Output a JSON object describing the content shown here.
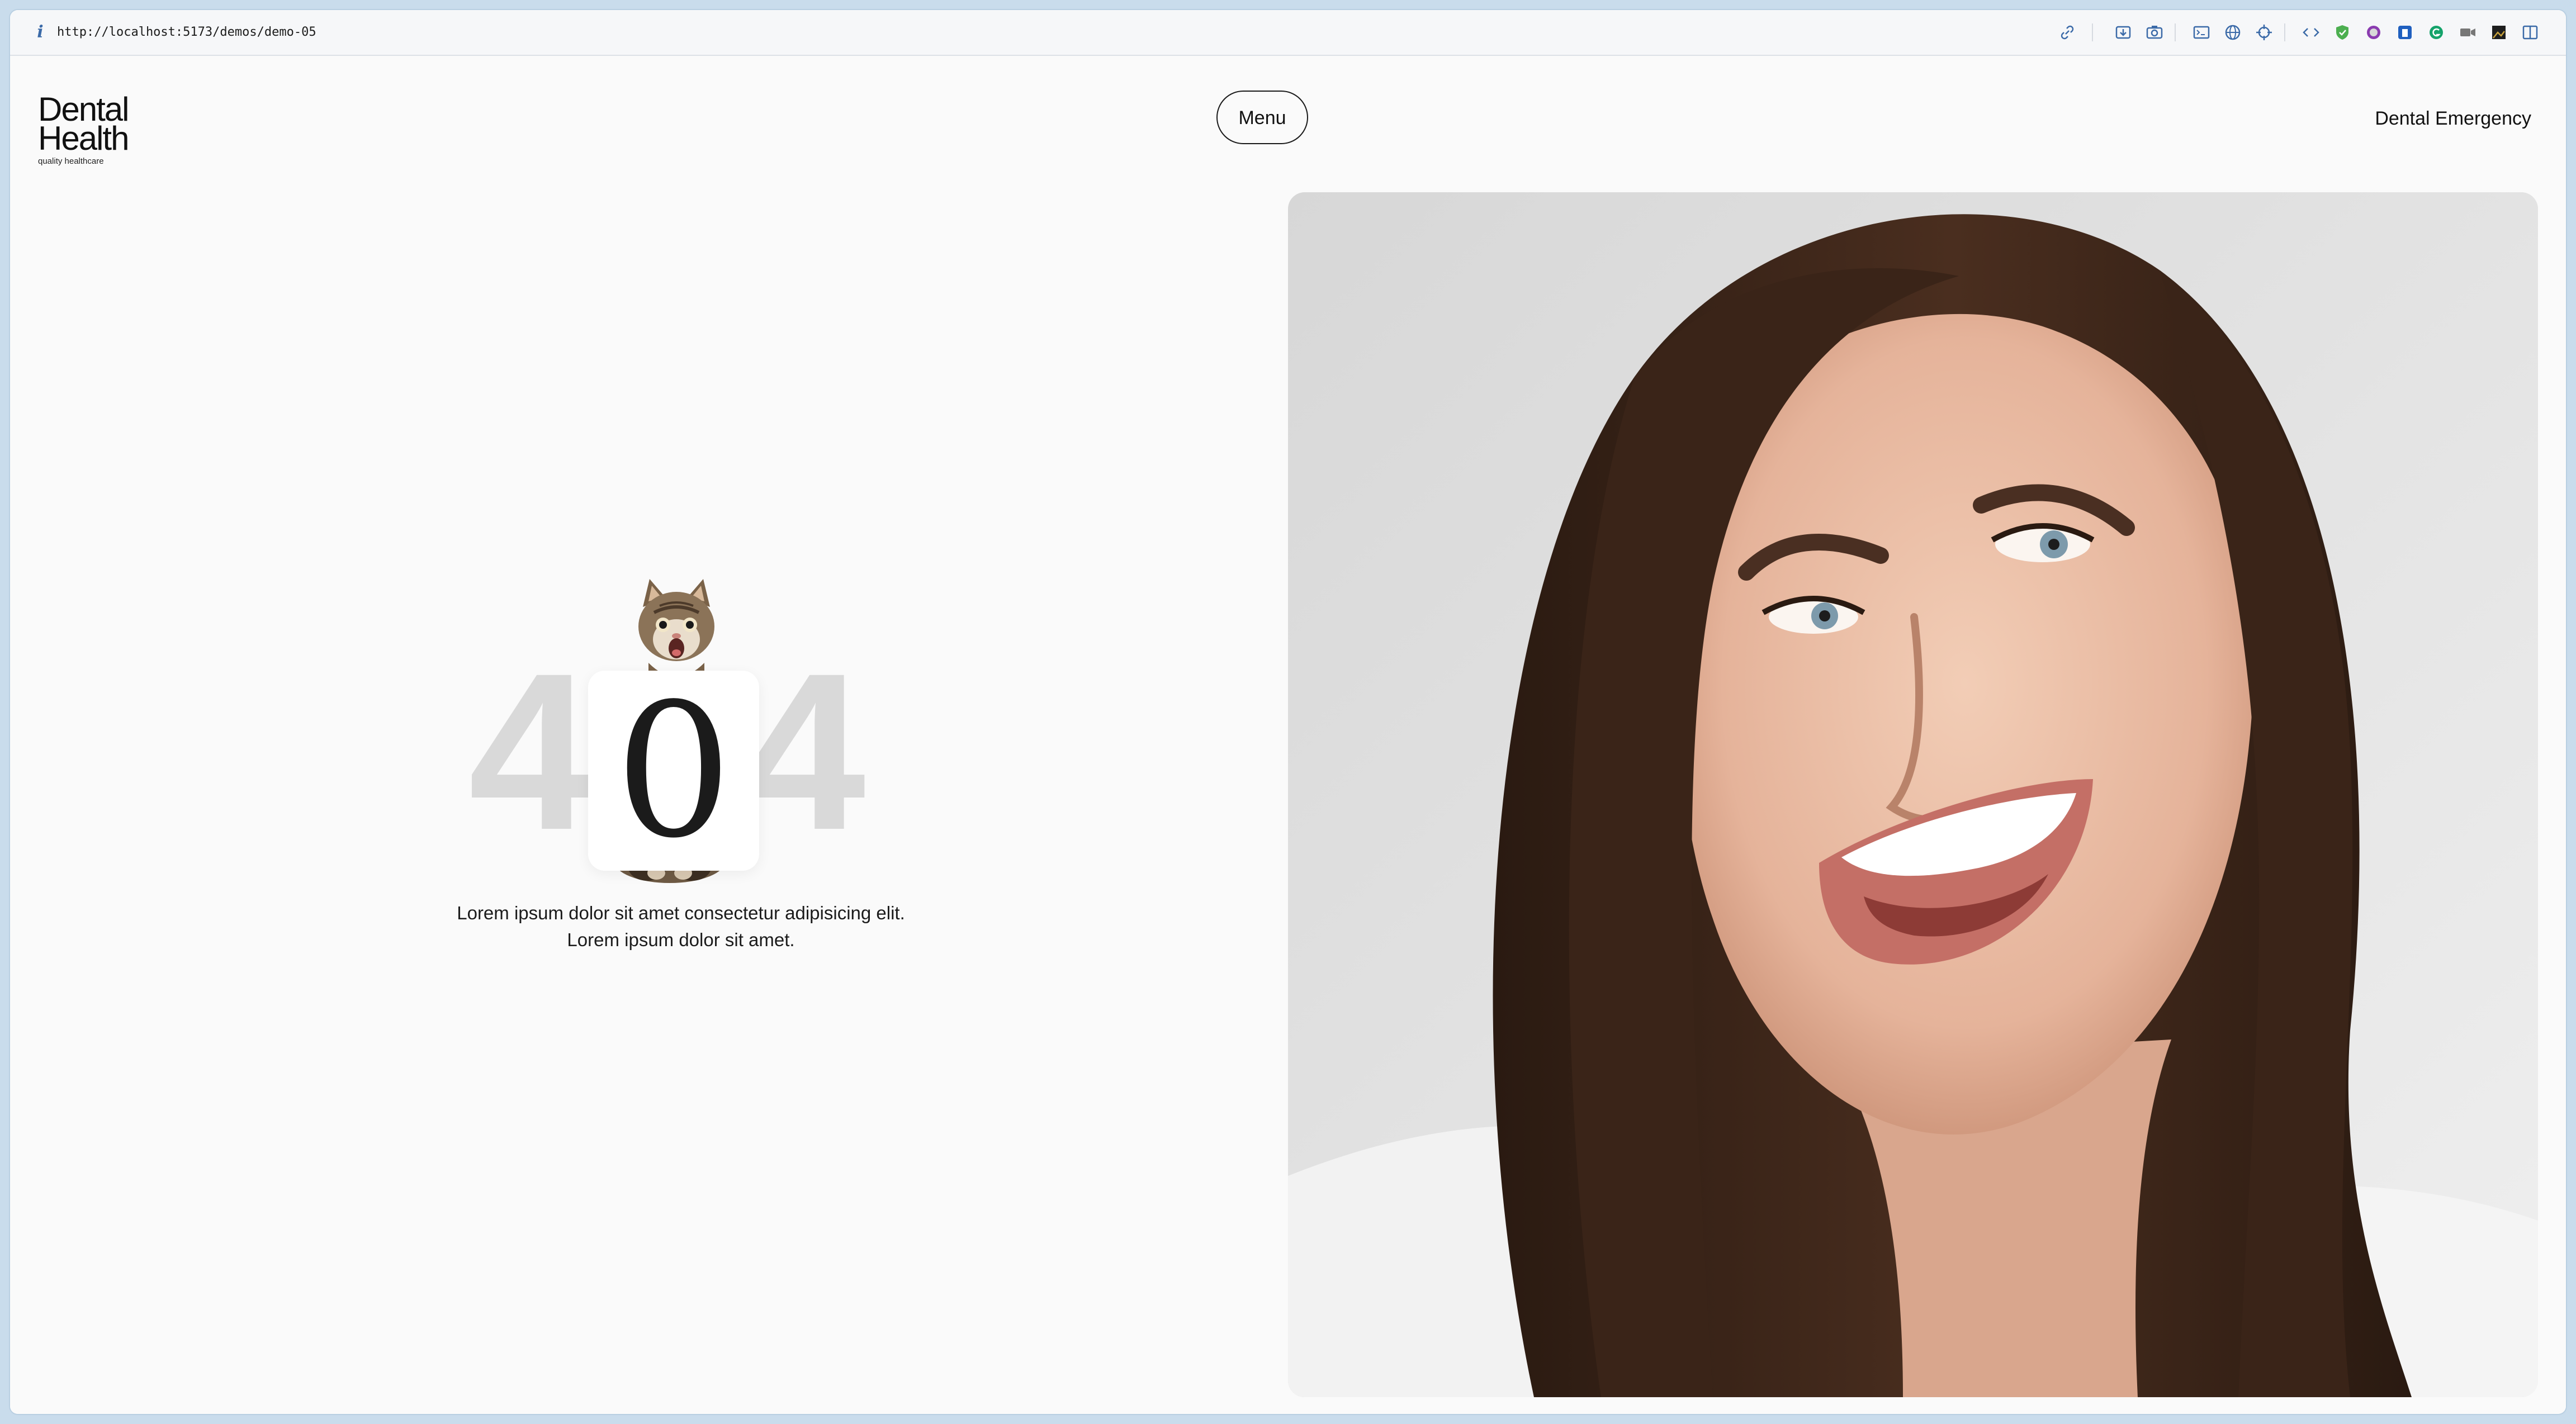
{
  "browser": {
    "url": "http://localhost:5173/demos/demo-05",
    "icons": [
      "info-icon",
      "link-icon",
      "download-icon",
      "camera-icon",
      "terminal-icon",
      "globe-icon",
      "crosshair-icon",
      "code-icon",
      "shield-icon",
      "color-icon",
      "extension-icon",
      "grammar-icon",
      "video-icon",
      "image-icon",
      "sidebar-icon"
    ]
  },
  "header": {
    "logo_line1": "Dental",
    "logo_line2": "Health",
    "logo_tagline": "quality healthcare",
    "menu_label": "Menu",
    "emergency_label": "Dental Emergency"
  },
  "error": {
    "digit_left": "4",
    "digit_middle": "0",
    "digit_right": "4",
    "line1": "Lorem ipsum dolor sit amet consectetur adipisicing elit.",
    "line2": "Lorem ipsum dolor sit amet."
  },
  "colors": {
    "page_bg": "#fafafa",
    "text": "#111111",
    "faded_digit": "#d9d9d9",
    "browser_accent": "#3b6aa8"
  }
}
